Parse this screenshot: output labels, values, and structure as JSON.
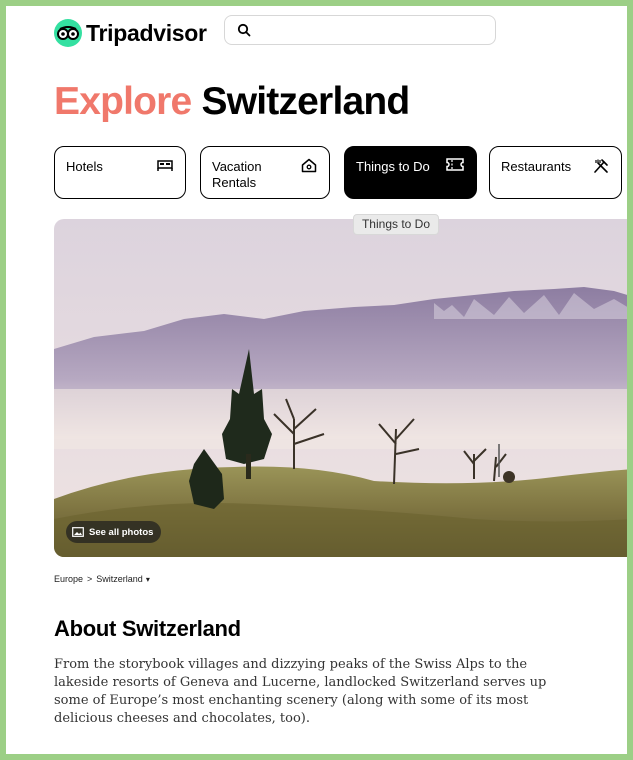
{
  "header": {
    "brand": "Tripadvisor",
    "search_placeholder": ""
  },
  "title": {
    "explore": "Explore",
    "country": "Switzerland"
  },
  "tabs": [
    {
      "label": "Hotels",
      "icon": "bed-icon",
      "active": false
    },
    {
      "label": "Vacation\nRentals",
      "icon": "house-icon",
      "active": false
    },
    {
      "label": "Things to Do",
      "icon": "ticket-icon",
      "active": true
    },
    {
      "label": "Restaurants",
      "icon": "fork-knife-icon",
      "active": false
    }
  ],
  "tooltip": "Things to Do",
  "hero": {
    "see_all": "See all photos"
  },
  "breadcrumb": {
    "items": [
      "Europe",
      "Switzerland"
    ],
    "separator": ">"
  },
  "about": {
    "heading": "About Switzerland",
    "text": "From the storybook villages and dizzying peaks of the Swiss Alps to the lakeside resorts of Geneva and Lucerne, landlocked Switzerland serves up some of Europe’s most enchanting scenery (along with some of its most delicious cheeses and chocolates, too)."
  },
  "colors": {
    "brand_green": "#34e0a1",
    "title_accent": "#f0786b",
    "frame_green": "#9ccf86"
  }
}
